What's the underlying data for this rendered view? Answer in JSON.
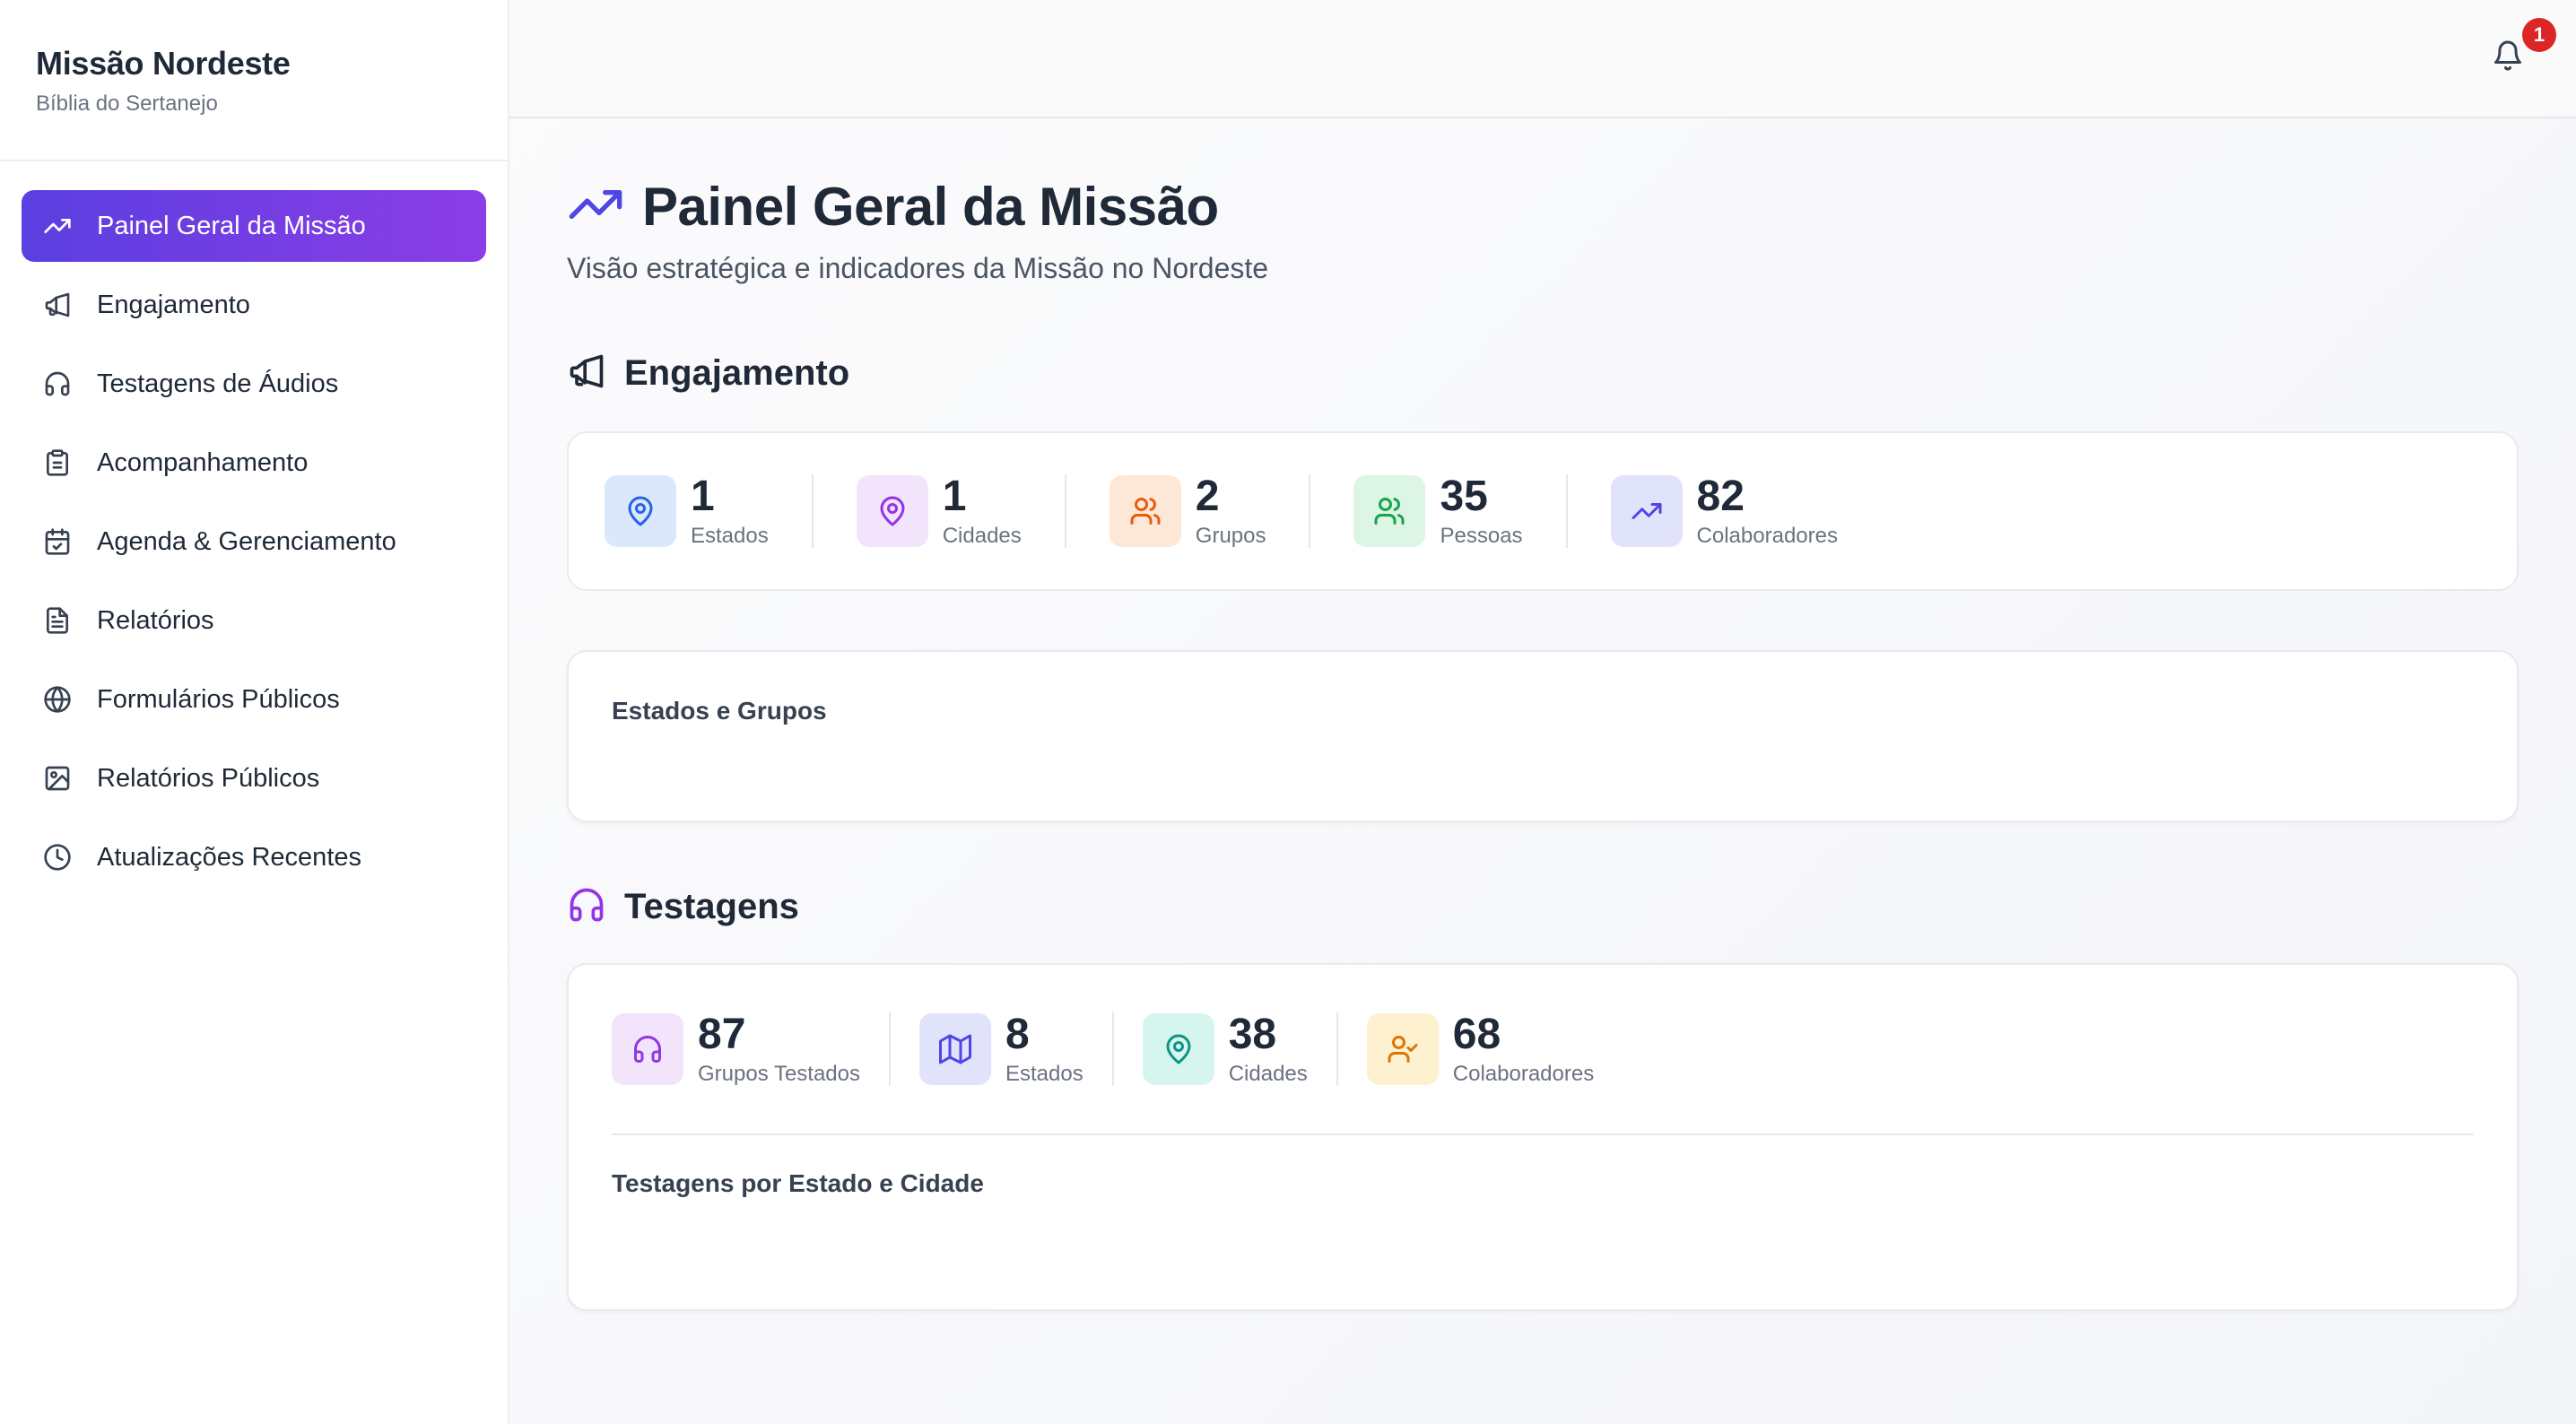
{
  "sidebar": {
    "title": "Missão Nordeste",
    "subtitle": "Bíblia do Sertanejo",
    "items": [
      {
        "label": "Painel Geral da Missão",
        "icon": "trending-up-icon",
        "active": true
      },
      {
        "label": "Engajamento",
        "icon": "megaphone-icon"
      },
      {
        "label": "Testagens de Áudios",
        "icon": "headphones-icon"
      },
      {
        "label": "Acompanhamento",
        "icon": "clipboard-icon"
      },
      {
        "label": "Agenda & Gerenciamento",
        "icon": "calendar-check-icon"
      },
      {
        "label": "Relatórios",
        "icon": "file-text-icon"
      },
      {
        "label": "Formulários Públicos",
        "icon": "globe-icon"
      },
      {
        "label": "Relatórios Públicos",
        "icon": "image-icon"
      },
      {
        "label": "Atualizações Recentes",
        "icon": "clock-icon"
      }
    ]
  },
  "topbar": {
    "notification_count": "1"
  },
  "page": {
    "title": "Painel Geral da Missão",
    "subtitle": "Visão estratégica e indicadores da Missão no Nordeste"
  },
  "engajamento": {
    "title": "Engajamento",
    "stats": [
      {
        "value": "1",
        "label": "Estados",
        "icon": "map-pin-icon"
      },
      {
        "value": "1",
        "label": "Cidades",
        "icon": "map-pin-icon"
      },
      {
        "value": "2",
        "label": "Grupos",
        "icon": "users-icon"
      },
      {
        "value": "35",
        "label": "Pessoas",
        "icon": "users-icon"
      },
      {
        "value": "82",
        "label": "Colaboradores",
        "icon": "trending-up-icon"
      }
    ],
    "chart_title": "Estados e Grupos"
  },
  "testagens": {
    "title": "Testagens",
    "stats": [
      {
        "value": "87",
        "label": "Grupos Testados",
        "icon": "headphones-icon"
      },
      {
        "value": "8",
        "label": "Estados",
        "icon": "map-icon"
      },
      {
        "value": "38",
        "label": "Cidades",
        "icon": "map-pin-icon"
      },
      {
        "value": "68",
        "label": "Colaboradores",
        "icon": "user-check-icon"
      }
    ],
    "chart_title": "Testagens por Estado e Cidade"
  },
  "colors": {
    "accent_start": "#5b3fe0",
    "accent_end": "#8b3de6",
    "badge": "#dc2626"
  }
}
